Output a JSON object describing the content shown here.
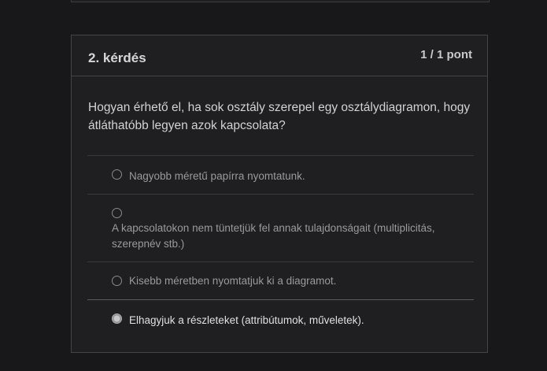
{
  "question": {
    "title": "2. kérdés",
    "points": "1 / 1 pont",
    "text": "Hogyan érhető el, ha sok osztály szerepel egy osztálydiagramon, hogy átláthatóbb legyen azok kapcsolata?"
  },
  "answers": [
    {
      "label": "Nagyobb méretű papírra nyomtatunk.",
      "selected": false
    },
    {
      "label": "A kapcsolatokon nem tüntetjük fel annak tulajdonságait (multiplicitás, szerepnév stb.)",
      "selected": false
    },
    {
      "label": "Kisebb méretben nyomtatjuk ki a diagramot.",
      "selected": false
    },
    {
      "label": "Elhagyjuk a részleteket (attribútumok, műveletek).",
      "selected": true
    }
  ]
}
